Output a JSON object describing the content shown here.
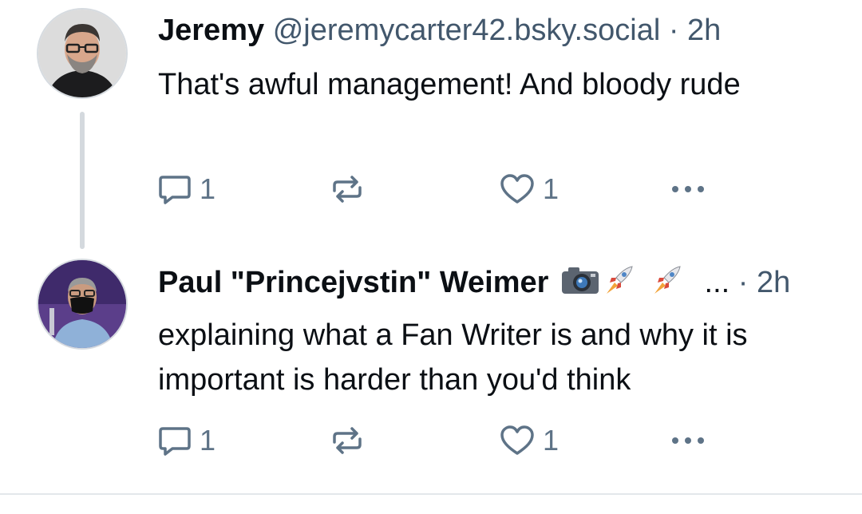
{
  "posts": [
    {
      "author_name": "Jeremy",
      "handle": "@jeremycarter42.bsky.social",
      "separator": "·",
      "time": "2h",
      "text": "That's awful management! And bloody rude",
      "replies": "1",
      "likes": "1"
    },
    {
      "author_name": "Paul \"Princejvstin\" Weimer",
      "name_overflow": "...",
      "separator": "·",
      "time": "2h",
      "text": "explaining what a Fan Writer is and why it is important is harder than you'd think",
      "replies": "1",
      "likes": "1"
    }
  ],
  "icons": {
    "reply": "speech-bubble-icon",
    "repost": "repost-arrows-icon",
    "like": "heart-outline-icon",
    "more": "ellipsis-icon",
    "name_emojis": [
      "camera-icon",
      "rocket-icon",
      "rocket-icon"
    ]
  },
  "colors": {
    "text": "#0b0f14",
    "muted": "#42576c",
    "icon": "#5e7387",
    "thread_line": "#d4d9de"
  }
}
